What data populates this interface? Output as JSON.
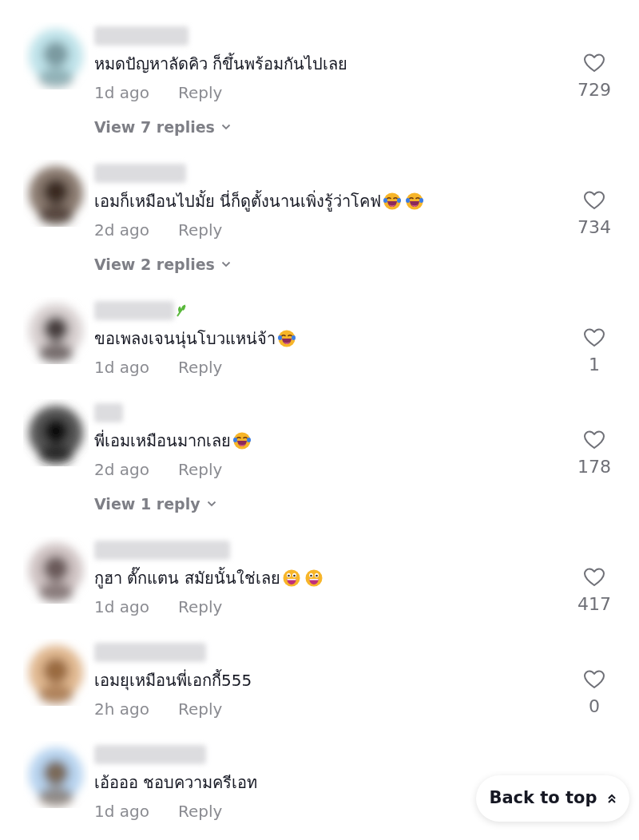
{
  "comments": [
    {
      "text": "หมดปัญหาลัดคิว ก็ขึ้นพร้อมกันไปเลย",
      "has_badge": false,
      "time": "1d ago",
      "reply": "Reply",
      "likes": "729",
      "view_replies": "View 7 replies"
    },
    {
      "text": "เอมก็เหมือนไปมั้ย นี่ก็ดูตั้งนานเพิ่งรู้ว่าโคฟ",
      "emojis": [
        {
          "kind": "tears-of-joy"
        },
        {
          "kind": "tears-of-joy"
        }
      ],
      "has_badge": false,
      "time": "2d ago",
      "reply": "Reply",
      "likes": "734",
      "view_replies": "View 2 replies"
    },
    {
      "text": "ขอเพลงเจนนุ่นโบวแหน่จ้า",
      "emojis": [
        {
          "kind": "tears-of-joy"
        }
      ],
      "has_badge": true,
      "time": "1d ago",
      "reply": "Reply",
      "likes": "1"
    },
    {
      "text": "พี่เอมเหมือนมากเลย",
      "emojis": [
        {
          "kind": "tears-of-joy"
        }
      ],
      "has_badge": false,
      "time": "2d ago",
      "reply": "Reply",
      "likes": "178",
      "view_replies": "View 1 reply"
    },
    {
      "text": "กูฮา ตั๊กแตน สมัยนั้นใช่เลย",
      "emojis": [
        {
          "kind": "grinning"
        },
        {
          "kind": "grinning"
        }
      ],
      "has_badge": false,
      "time": "1d ago",
      "reply": "Reply",
      "likes": "417"
    },
    {
      "text": "เอมยุเหมือนพี่เอกกี้555",
      "has_badge": false,
      "time": "2h ago",
      "reply": "Reply",
      "likes": "0"
    },
    {
      "text": "เอ้อออ ชอบความครีเอท",
      "has_badge": false,
      "time": "1d ago",
      "reply": "Reply"
    }
  ],
  "back_to_top": {
    "label": "Back to top"
  }
}
